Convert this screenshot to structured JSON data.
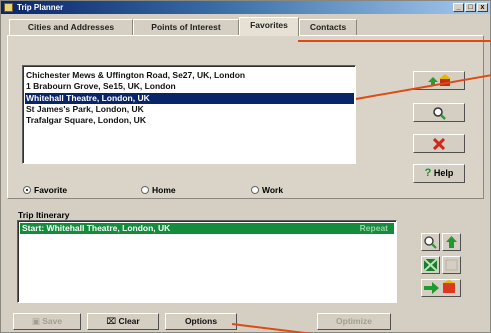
{
  "window": {
    "title": "Trip Planner",
    "controls": {
      "minimize": "_",
      "maximize": "□",
      "close": "x"
    }
  },
  "tabs": [
    {
      "label": "Cities and Addresses",
      "active": false
    },
    {
      "label": "Points of Interest",
      "active": false
    },
    {
      "label": "Favorites",
      "active": true
    },
    {
      "label": "Contacts",
      "active": false
    }
  ],
  "favorites": {
    "items": [
      {
        "label": "Chichester Mews & Uffington Road, Se27, UK, London",
        "selected": false
      },
      {
        "label": "1 Brabourn Grove, Se15, UK, London",
        "selected": false
      },
      {
        "label": "Whitehall Theatre, London, UK",
        "selected": true
      },
      {
        "label": "St James's Park, London, UK",
        "selected": false
      },
      {
        "label": "Trafalgar Square, London, UK",
        "selected": false
      }
    ],
    "radios": [
      {
        "label": "Favorite",
        "checked": true
      },
      {
        "label": "Home",
        "checked": false
      },
      {
        "label": "Work",
        "checked": false
      }
    ]
  },
  "side_buttons": {
    "add_icon": "add-favorite-icon",
    "find_icon": "magnifier-icon",
    "delete_icon": "red-x-icon",
    "help_label": "Help",
    "help_icon": "question-mark-icon"
  },
  "itinerary": {
    "label": "Trip Itinerary",
    "rows": [
      {
        "label": "Start: Whitehall Theatre, London, UK",
        "flag": "Repeat"
      }
    ]
  },
  "bottom": {
    "save_label": "Save",
    "clear_label": "Clear",
    "options_label": "Options",
    "optimize_label": "Optimize"
  },
  "colors": {
    "selection": "#0a246a",
    "itinerary_highlight": "#138c3c",
    "callout": "#e04a12"
  }
}
